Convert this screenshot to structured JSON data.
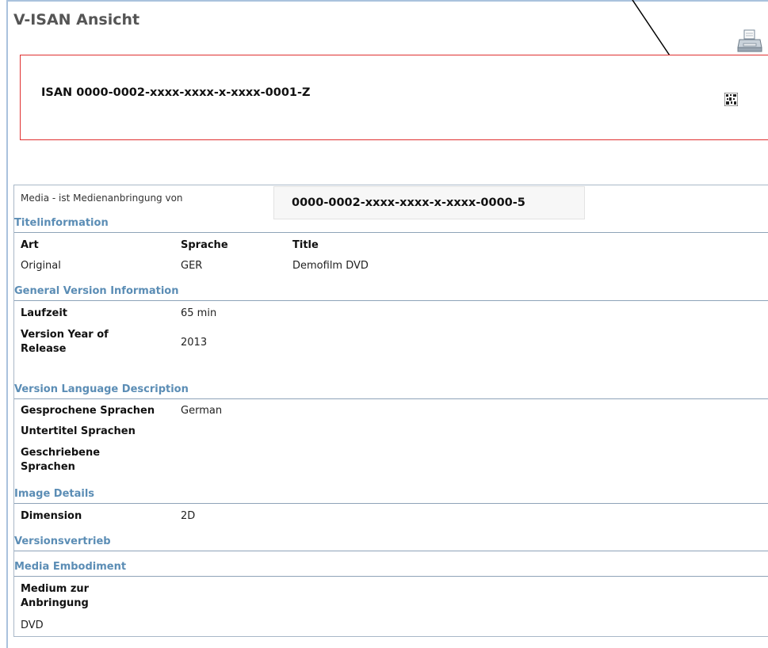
{
  "page": {
    "title": "V-ISAN Ansicht"
  },
  "header": {
    "isan_label": "ISAN 0000-0002-xxxx-xxxx-x-xxxx-0001-Z",
    "print_icon": "printer-icon",
    "code_icon": "qr-code-icon"
  },
  "media": {
    "relation_label": "Media - ist Medienanbringung von",
    "relation_value": "0000-0002-xxxx-xxxx-x-xxxx-0000-5"
  },
  "title_info": {
    "heading": "Titelinformation",
    "columns": [
      "Art",
      "Sprache",
      "Title"
    ],
    "rows": [
      [
        "Original",
        "GER",
        "Demofilm DVD"
      ]
    ]
  },
  "general_version": {
    "heading": "General Version Information",
    "runtime_label": "Laufzeit",
    "runtime_value": "65 min",
    "year_label_1": "Version Year of",
    "year_label_2": "Release",
    "year_value": "2013"
  },
  "language": {
    "heading": "Version Language Description",
    "spoken_label": "Gesprochene Sprachen",
    "spoken_value": "German",
    "subtitle_label": "Untertitel Sprachen",
    "written_label_1": "Geschriebene",
    "written_label_2": "Sprachen"
  },
  "image_details": {
    "heading": "Image Details",
    "dimension_label": "Dimension",
    "dimension_value": "2D"
  },
  "distribution": {
    "heading": "Versionsvertrieb"
  },
  "embodiment": {
    "heading": "Media Embodiment",
    "medium_label_1": "Medium zur",
    "medium_label_2": "Anbringung",
    "medium_value": "DVD"
  }
}
